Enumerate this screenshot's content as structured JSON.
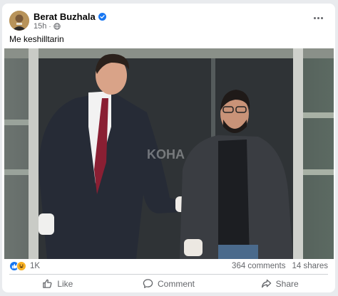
{
  "post": {
    "author": "Berat Buzhala",
    "time": "15h",
    "caption": "Me keshilltarin",
    "watermark": "KOHA",
    "reactions_count": "1K",
    "comments_count": "364 comments",
    "shares_count": "14 shares"
  },
  "actions": {
    "like": "Like",
    "comment": "Comment",
    "share": "Share"
  },
  "icons": {
    "verified": "verified-badge-icon",
    "audience": "globe-icon",
    "menu": "more-horizontal-icon",
    "like_reaction": "thumbs-up-reaction-icon",
    "haha_reaction": "haha-reaction-icon",
    "like_action": "thumbs-up-outline-icon",
    "comment_action": "speech-bubble-icon",
    "share_action": "share-arrow-icon"
  },
  "colors": {
    "brand": "#1877f2",
    "secondary_text": "#65676b",
    "background": "#e9ebee"
  }
}
